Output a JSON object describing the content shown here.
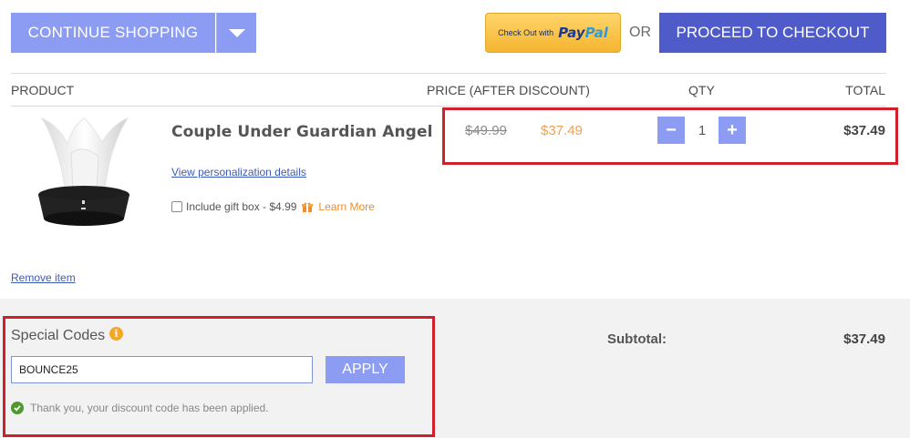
{
  "header": {
    "continue_label": "CONTINUE SHOPPING",
    "paypal_prefix": "Check Out with",
    "paypal_brand_a": "Pay",
    "paypal_brand_b": "Pal",
    "or_label": "OR",
    "checkout_label": "PROCEED TO CHECKOUT"
  },
  "columns": {
    "product": "PRODUCT",
    "price": "PRICE (AFTER DISCOUNT)",
    "qty": "QTY",
    "total": "TOTAL"
  },
  "item": {
    "name": "Couple Under Guardian Angel",
    "personalize_link": "View personalization details",
    "gift_label": "Include gift box - $4.99",
    "gift_checked": false,
    "learn_more": "Learn More",
    "old_price": "$49.99",
    "new_price": "$37.49",
    "qty": "1",
    "line_total": "$37.49",
    "remove_link": "Remove item"
  },
  "codes": {
    "title": "Special Codes",
    "input_value": "BOUNCE25",
    "apply_label": "APPLY",
    "success_message": "Thank you, your discount code has been applied."
  },
  "summary": {
    "subtotal_label": "Subtotal:",
    "subtotal_value": "$37.49"
  },
  "icons": {
    "dropdown": "chevron-down-icon",
    "gift": "gift-icon",
    "info": "info-icon",
    "success": "check-circle-icon"
  },
  "colors": {
    "primary_button": "#8c9cf2",
    "checkout_button": "#4e5bc9",
    "accent_orange": "#f0a050",
    "highlight_red": "#d0202c",
    "panel_bg": "#f2f2f2"
  }
}
